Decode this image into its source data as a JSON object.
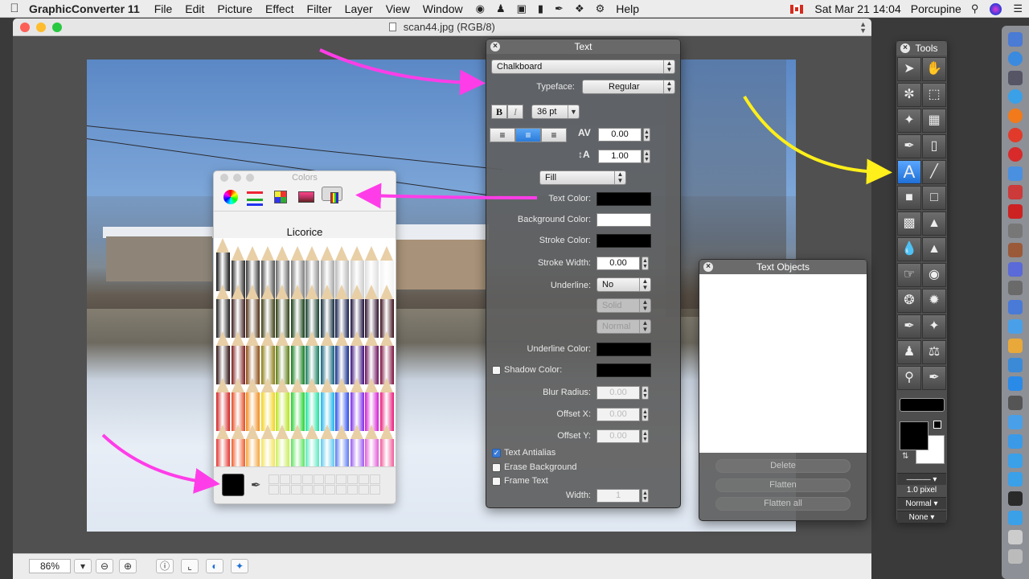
{
  "menubar": {
    "app_name": "GraphicConverter 11",
    "items": [
      "File",
      "Edit",
      "Picture",
      "Effect",
      "Filter",
      "Layer",
      "View",
      "Window"
    ],
    "help": "Help",
    "datetime": "Sat Mar 21  14:04",
    "user": "Porcupine"
  },
  "document": {
    "title": "scan44.jpg (RGB/8)",
    "zoom": "86%"
  },
  "colors_panel": {
    "title": "Colors",
    "color_name": "Licorice",
    "pencil_colors": [
      [
        "#111111",
        "#1a1a1a",
        "#2b0e0e",
        "#d01f1f",
        "#e2332e"
      ],
      [
        "#2a2a2a",
        "#3a1a1a",
        "#7a1a18",
        "#e2481f",
        "#ee5a2a"
      ],
      [
        "#3a3a3a",
        "#4a2a10",
        "#8a4a10",
        "#f08a1a",
        "#f4a43c"
      ],
      [
        "#505050",
        "#3a3a10",
        "#8a7a10",
        "#f2d21a",
        "#f3e25a"
      ],
      [
        "#666666",
        "#2a3a10",
        "#5a7a10",
        "#b6e21a",
        "#caee5a"
      ],
      [
        "#7a7a7a",
        "#103a10",
        "#107a1a",
        "#22d02a",
        "#5ae25a"
      ],
      [
        "#8e8e8e",
        "#103a2a",
        "#107a5a",
        "#1ae0a0",
        "#5ae8c0"
      ],
      [
        "#a4a4a4",
        "#102a3a",
        "#10607a",
        "#1ab4e8",
        "#5ac8ee"
      ],
      [
        "#b8b8b8",
        "#101a4a",
        "#102a8a",
        "#2a4ae8",
        "#5a78f0"
      ],
      [
        "#cccccc",
        "#1a0e3a",
        "#3a0e7a",
        "#7a2ae8",
        "#9a5af0"
      ],
      [
        "#dedede",
        "#2a0e2a",
        "#6a0e5a",
        "#d21ad2",
        "#e25ad8"
      ],
      [
        "#f2f2f2",
        "#3a0e1a",
        "#7a0e3a",
        "#e81a7a",
        "#f05a98"
      ]
    ],
    "colors": {
      "swatch": "#000000"
    }
  },
  "text_panel": {
    "title": "Text",
    "font": "Chalkboard",
    "typeface_label": "Typeface:",
    "typeface": "Regular",
    "bold": "B",
    "italic": "I",
    "size": "36 pt",
    "kerning": "0.00",
    "leading": "1.00",
    "fill_mode": "Fill",
    "text_color_label": "Text Color:",
    "background_color_label": "Background Color:",
    "stroke_color_label": "Stroke Color:",
    "stroke_width_label": "Stroke Width:",
    "stroke_width": "0.00",
    "underline_label": "Underline:",
    "underline": "No",
    "underline_style": "Solid",
    "underline_weight": "Normal",
    "underline_color_label": "Underline Color:",
    "shadow_color_label": "Shadow Color:",
    "blur_radius_label": "Blur Radius:",
    "blur_radius": "0.00",
    "offset_x_label": "Offset X:",
    "offset_x": "0.00",
    "offset_y_label": "Offset Y:",
    "offset_y": "0.00",
    "antialias_label": "Text Antialias",
    "erase_bg_label": "Erase Background",
    "frame_text_label": "Frame Text",
    "width_label": "Width:",
    "width": "1"
  },
  "text_objects": {
    "title": "Text Objects",
    "delete": "Delete",
    "flatten": "Flatten",
    "flatten_all": "Flatten all"
  },
  "tools_panel": {
    "title": "Tools",
    "line_width": "1.0 pixel",
    "mode": "Normal",
    "none": "None",
    "icons": [
      "pointer-icon",
      "hand-icon",
      "lasso-icon",
      "marquee-icon",
      "magic-wand-icon",
      "checker-icon",
      "brush-icon",
      "eraser-icon",
      "text-tool-icon",
      "line-icon",
      "filled-rect-icon",
      "rect-icon",
      "bucket-icon",
      "stamp-icon",
      "drop-icon",
      "cone-icon",
      "finger-icon",
      "sponge-icon",
      "broom-icon",
      "paint-tube-icon",
      "pipette-icon",
      "magic-brush-icon",
      "silhouette-icon",
      "caliper-icon",
      "zoom-tool-icon",
      "syringe-icon"
    ]
  },
  "arrow_colors": {
    "magenta": "#ff3de8",
    "yellow": "#ffef1a"
  }
}
